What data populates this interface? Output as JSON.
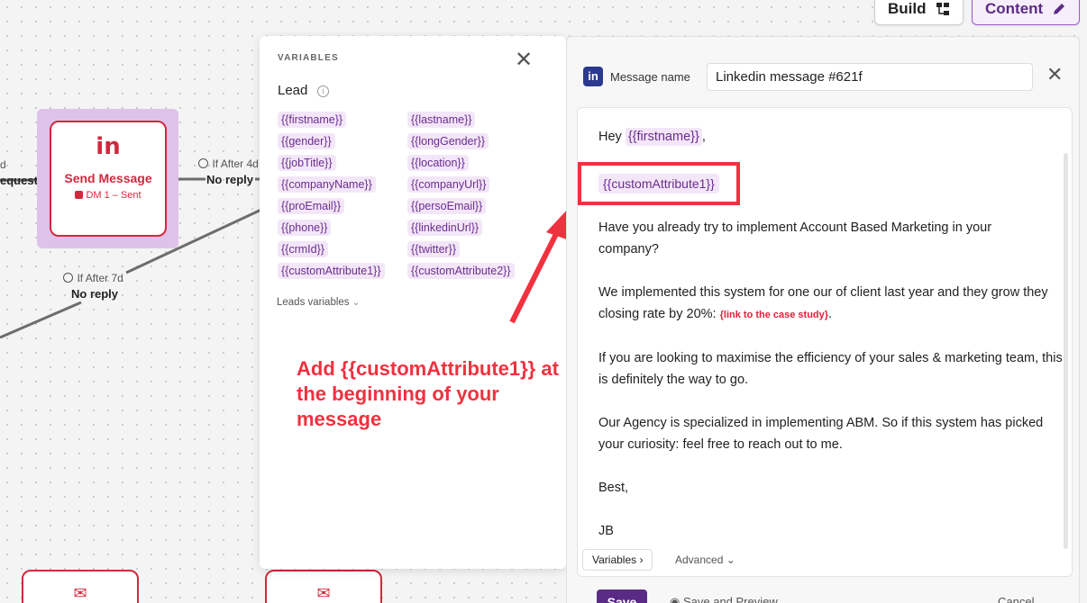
{
  "toolbar": {
    "build_label": "Build",
    "content_label": "Content"
  },
  "flow": {
    "node": {
      "icon": "in",
      "title": "Send Message",
      "subtitle": "DM 1 – Sent"
    },
    "left_label_top": "d",
    "left_label_request": "equest",
    "edge1": {
      "timing": "If After 4d",
      "label": "No reply"
    },
    "edge2": {
      "timing": "If After 7d",
      "label": "No reply"
    },
    "bottom_icon": "✉"
  },
  "variables_panel": {
    "header": "VARIABLES",
    "section": "Lead",
    "left_column": [
      "{{firstname}}",
      "{{gender}}",
      "{{jobTitle}}",
      "{{companyName}}",
      "{{proEmail}}",
      "{{phone}}",
      "{{crmId}}",
      "{{customAttribute1}}"
    ],
    "right_column": [
      "{{lastname}}",
      "{{longGender}}",
      "{{location}}",
      "{{companyUrl}}",
      "{{persoEmail}}",
      "{{linkedinUrl}}",
      "{{twitter}}",
      "{{customAttribute2}}"
    ],
    "leads_variables": "Leads variables",
    "annotation": "Add {{customAttribute1}} at the beginning of your message"
  },
  "editor": {
    "badge": "in",
    "message_name_label": "Message name",
    "message_name_value": "Linkedin message #621f",
    "greeting_prefix": "Hey",
    "greeting_chip": "{{firstname}}",
    "greeting_suffix": ",",
    "custom_chip": "{{customAttribute1}}",
    "para1": "Have you already try to implement Account Based Marketing in your company?",
    "para2": "We implemented this system for one our of client last year and they grow they closing rate by 20%:",
    "para2_link": "{link to the case study}",
    "para2_end": ".",
    "para3": "If you are looking to maximise the efficiency of your sales & marketing team, this is definitely the way to go.",
    "para4": "Our Agency is specialized in implementing ABM. So if this system has picked your curiosity: feel free to reach out to me.",
    "sign1": "Best,",
    "sign2": "JB",
    "variables_btn": "Variables",
    "advanced_btn": "Advanced",
    "save": "Save",
    "save_preview": "Save and Preview",
    "cancel": "Cancel"
  },
  "colors": {
    "accent": "#5b2a86",
    "node_red": "#d1293d",
    "annotation_red": "#f0313f",
    "chip_bg": "#f3e6f8"
  }
}
